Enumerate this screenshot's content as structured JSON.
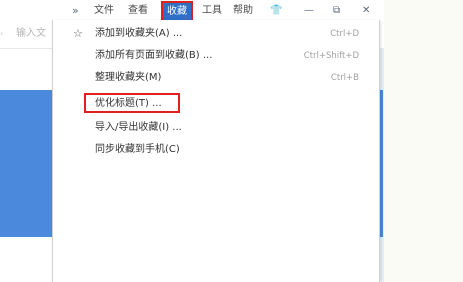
{
  "menubar": {
    "more_glyph": "»",
    "file": "文件",
    "view": "查看",
    "favorites": "收藏",
    "tools": "工具",
    "help": "帮助",
    "skin_glyph": "👕",
    "minimize_glyph": "—",
    "restore_glyph": "⧉",
    "close_glyph": "✕"
  },
  "address": {
    "fade_text": "‹",
    "placeholder": "输入文"
  },
  "favorites_menu": {
    "items": [
      {
        "label": "添加到收藏夹(A) ...",
        "shortcut": "Ctrl+D",
        "icon": "star-icon"
      },
      {
        "label": "添加所有页面到收藏(B) ...",
        "shortcut": "Ctrl+Shift+D"
      },
      {
        "label": "整理收藏夹(M)",
        "shortcut": "Ctrl+B"
      },
      {
        "label": "优化标题(T) ...",
        "shortcut": ""
      },
      {
        "label": "导入/导出收藏(I) ...",
        "shortcut": ""
      },
      {
        "label": "同步收藏到手机(C)",
        "shortcut": ""
      }
    ]
  },
  "colors": {
    "accent_blue": "#2f6fc8",
    "highlight_red": "#e11f1f",
    "content_blue": "#4a89dc"
  }
}
